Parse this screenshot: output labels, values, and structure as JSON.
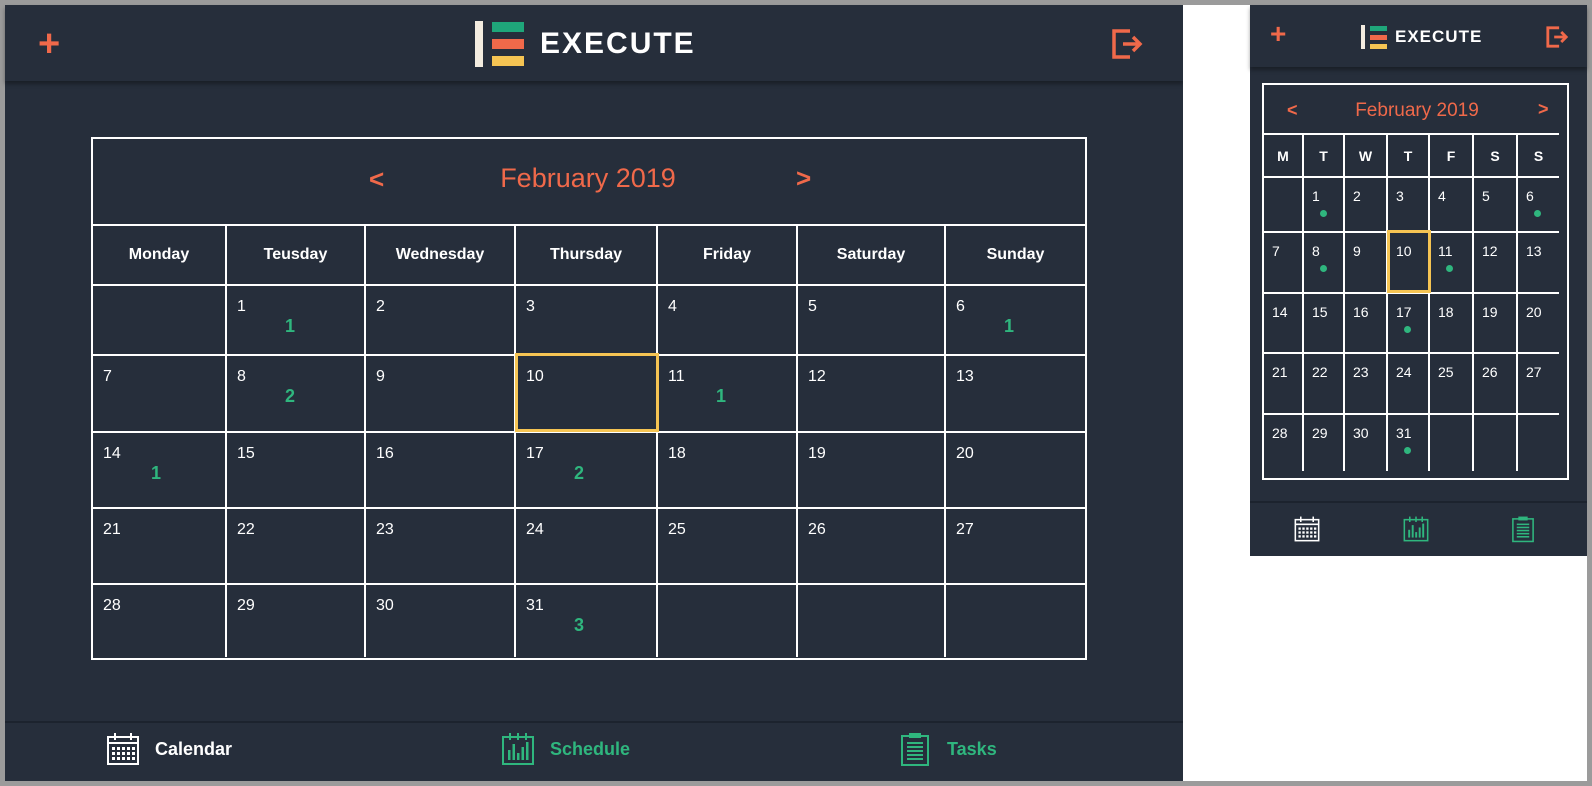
{
  "app": {
    "logo_text": "EXECUTE",
    "logo_colors": [
      "#1fa67a",
      "#f0694a",
      "#f5c453"
    ],
    "add_icon": "plus-icon",
    "logout_icon": "logout-icon",
    "accent": "#f0694a",
    "count_color": "#2fb67e",
    "today_color": "#f5c453"
  },
  "desktop": {
    "calendar": {
      "month_label": "February 2019",
      "prev_label": "<",
      "next_label": ">",
      "weekdays": [
        "Monday",
        "Teusday",
        "Wednesday",
        "Thursday",
        "Friday",
        "Saturday",
        "Sunday"
      ],
      "weeks": [
        [
          {
            "d": ""
          },
          {
            "d": "1",
            "c": "1"
          },
          {
            "d": "2"
          },
          {
            "d": "3"
          },
          {
            "d": "4"
          },
          {
            "d": "5"
          },
          {
            "d": "6",
            "c": "1"
          }
        ],
        [
          {
            "d": "7"
          },
          {
            "d": "8",
            "c": "2"
          },
          {
            "d": "9"
          },
          {
            "d": "10",
            "today": true
          },
          {
            "d": "11",
            "c": "1"
          },
          {
            "d": "12"
          },
          {
            "d": "13"
          }
        ],
        [
          {
            "d": "14",
            "c": "1"
          },
          {
            "d": "15"
          },
          {
            "d": "16"
          },
          {
            "d": "17",
            "c": "2"
          },
          {
            "d": "18"
          },
          {
            "d": "19"
          },
          {
            "d": "20"
          }
        ],
        [
          {
            "d": "21"
          },
          {
            "d": "22"
          },
          {
            "d": "23"
          },
          {
            "d": "24"
          },
          {
            "d": "25"
          },
          {
            "d": "26"
          },
          {
            "d": "27"
          }
        ],
        [
          {
            "d": "28"
          },
          {
            "d": "29"
          },
          {
            "d": "30"
          },
          {
            "d": "31",
            "c": "3"
          },
          {
            "d": ""
          },
          {
            "d": ""
          },
          {
            "d": ""
          }
        ]
      ]
    },
    "nav": [
      {
        "label": "Calendar",
        "icon": "calendar-icon",
        "color": "#ffffff"
      },
      {
        "label": "Schedule",
        "icon": "schedule-icon",
        "color": "#2fb67e"
      },
      {
        "label": "Tasks",
        "icon": "tasks-icon",
        "color": "#2fb67e"
      }
    ]
  },
  "mobile": {
    "calendar": {
      "month_label": "February 2019",
      "prev_label": "<",
      "next_label": ">",
      "weekdays": [
        "M",
        "T",
        "W",
        "T",
        "F",
        "S",
        "S"
      ],
      "weeks": [
        [
          {
            "d": ""
          },
          {
            "d": "1",
            "dot": true
          },
          {
            "d": "2"
          },
          {
            "d": "3"
          },
          {
            "d": "4"
          },
          {
            "d": "5"
          },
          {
            "d": "6",
            "dot": true
          }
        ],
        [
          {
            "d": "7"
          },
          {
            "d": "8",
            "dot": true
          },
          {
            "d": "9"
          },
          {
            "d": "10",
            "today": true
          },
          {
            "d": "11",
            "dot": true
          },
          {
            "d": "12"
          },
          {
            "d": "13"
          }
        ],
        [
          {
            "d": "14"
          },
          {
            "d": "15"
          },
          {
            "d": "16"
          },
          {
            "d": "17",
            "dot": true
          },
          {
            "d": "18"
          },
          {
            "d": "19"
          },
          {
            "d": "20"
          }
        ],
        [
          {
            "d": "21"
          },
          {
            "d": "22"
          },
          {
            "d": "23"
          },
          {
            "d": "24"
          },
          {
            "d": "25"
          },
          {
            "d": "26"
          },
          {
            "d": "27"
          }
        ],
        [
          {
            "d": "28"
          },
          {
            "d": "29"
          },
          {
            "d": "30"
          },
          {
            "d": "31",
            "dot": true
          },
          {
            "d": ""
          },
          {
            "d": ""
          },
          {
            "d": ""
          }
        ]
      ]
    },
    "nav": [
      {
        "icon": "calendar-icon",
        "color": "#ffffff"
      },
      {
        "icon": "schedule-icon",
        "color": "#2fb67e"
      },
      {
        "icon": "tasks-icon",
        "color": "#2fb67e"
      }
    ]
  }
}
